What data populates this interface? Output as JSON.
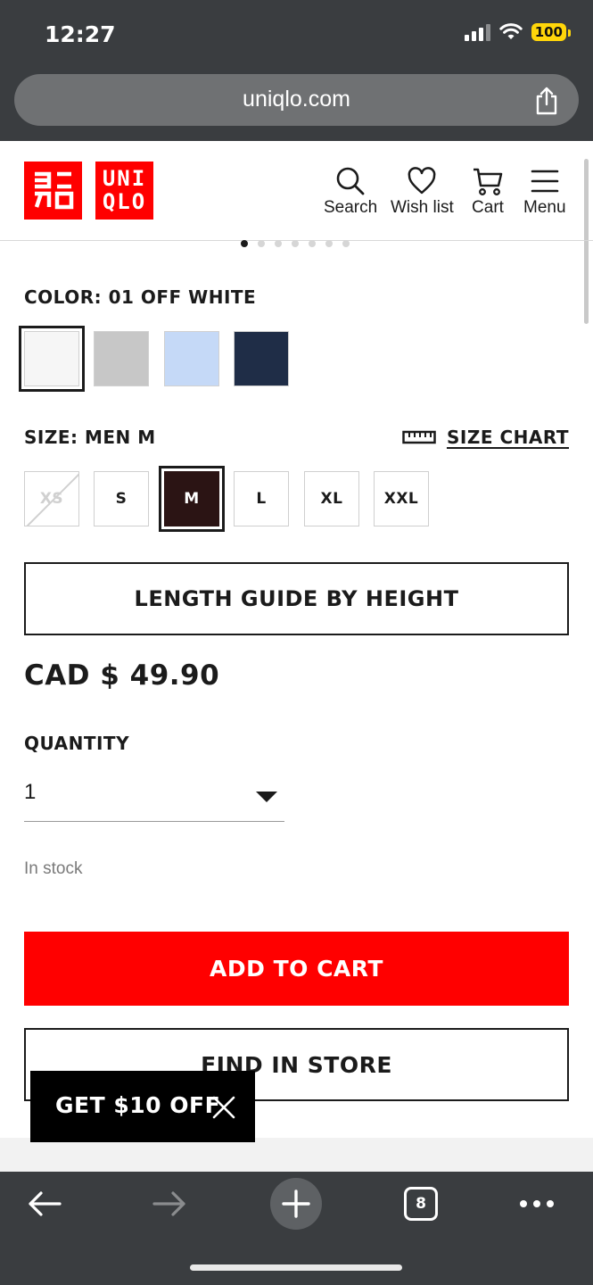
{
  "status_bar": {
    "time": "12:27",
    "battery": "100"
  },
  "url_bar": {
    "url": "uniqlo.com"
  },
  "header": {
    "logo_top": "ユニ\nクロ",
    "logo_text": "UNI\nQLO",
    "nav": [
      {
        "label": "Search",
        "icon": "search-icon"
      },
      {
        "label": "Wish list",
        "icon": "heart-icon"
      },
      {
        "label": "Cart",
        "icon": "cart-icon"
      },
      {
        "label": "Menu",
        "icon": "menu-icon"
      }
    ]
  },
  "carousel": {
    "total": 7,
    "active": 1
  },
  "color": {
    "label": "COLOR: 01 OFF WHITE",
    "swatches": [
      "#f6f6f6",
      "#c7c7c7",
      "#c5d9f7",
      "#1f2d47"
    ]
  },
  "size": {
    "label": "SIZE: MEN M",
    "chart_link": "SIZE CHART",
    "options": [
      "XS",
      "S",
      "M",
      "L",
      "XL",
      "XXL"
    ],
    "selected": "M",
    "unavailable": [
      "XS"
    ]
  },
  "length_guide": "LENGTH GUIDE BY HEIGHT",
  "price": "CAD $ 49.90",
  "quantity": {
    "label": "QUANTITY",
    "value": "1"
  },
  "stock_status": "In stock",
  "buttons": {
    "add_to_cart": "ADD TO CART",
    "find_in_store": "FIND IN STORE"
  },
  "promo": {
    "text": "GET $10 OFF"
  },
  "browser_bottom": {
    "tab_count": "8"
  },
  "colors": {
    "brand_red": "#ff0000",
    "selected_size_bg": "#2b1414"
  }
}
